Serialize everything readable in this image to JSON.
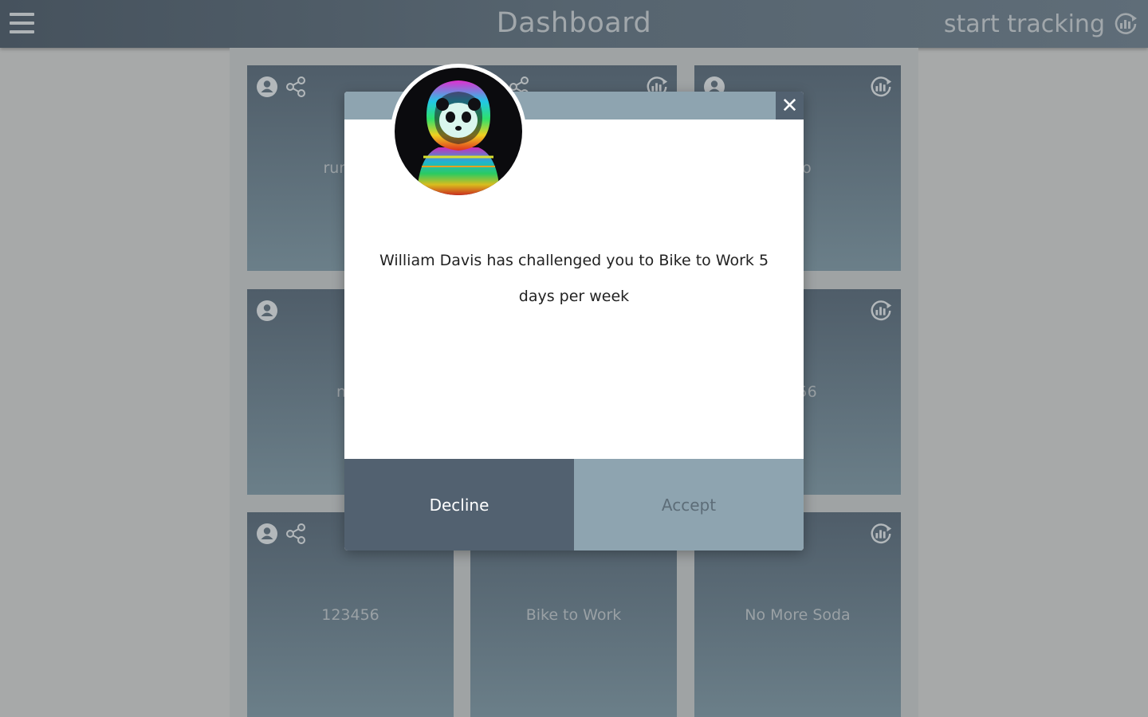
{
  "header": {
    "title": "Dashboard",
    "start_tracking_label": "start tracking",
    "menu_icon": "hamburger-menu-icon",
    "track_icon": "chart-refresh-icon"
  },
  "tiles": [
    {
      "title": "run ma",
      "icons": [
        "user-icon",
        "share-icon"
      ]
    },
    {
      "title": "",
      "icons": [
        "share-icon",
        "chart-refresh-icon"
      ]
    },
    {
      "title": "two",
      "icons": [
        "user-icon",
        "chart-refresh-icon"
      ]
    },
    {
      "title": "nev",
      "icons": [
        "user-icon"
      ]
    },
    {
      "title": "",
      "icons": []
    },
    {
      "title": "g456",
      "icons": [
        "chart-refresh-icon"
      ]
    },
    {
      "title": "123456",
      "icons": [
        "user-icon",
        "share-icon"
      ]
    },
    {
      "title": "Bike to Work",
      "icons": []
    },
    {
      "title": "No More Soda",
      "icons": [
        "chart-refresh-icon"
      ]
    }
  ],
  "modal": {
    "close_label": "✕",
    "message": "William Davis has challenged you to Bike to Work 5 days per week",
    "decline_label": "Decline",
    "accept_label": "Accept",
    "avatar": "panda-astronaut-avatar"
  },
  "colors": {
    "header": "#4f5c67",
    "tile": "#5f6f7b",
    "modal_dark": "#526170",
    "modal_light": "#8ea4b0"
  }
}
